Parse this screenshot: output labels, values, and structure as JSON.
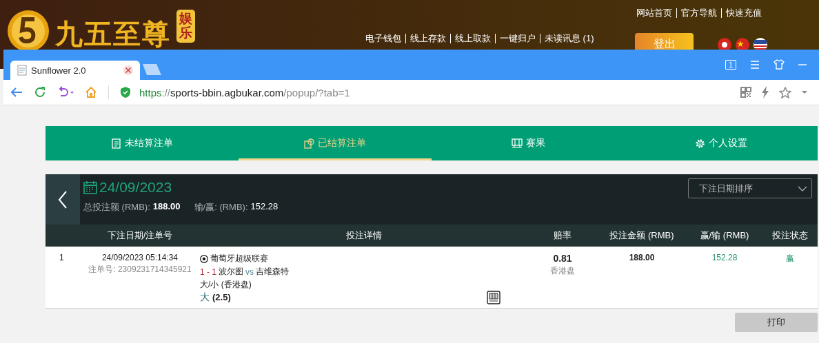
{
  "site": {
    "logo_text": "九五至尊",
    "logo_badge": "娱乐",
    "top_links": [
      "网站首页",
      "官方导航",
      "快速充值"
    ],
    "nav_links": [
      "电子钱包",
      "线上存款",
      "线上取款",
      "一键归户",
      "未读讯息 (1)"
    ],
    "logout": "登出"
  },
  "browser": {
    "tab_title": "Sunflower 2.0",
    "window_count": "1",
    "url_parts": [
      {
        "kind": "scheme",
        "text": "https"
      },
      {
        "kind": "sep",
        "text": "://"
      },
      {
        "kind": "host",
        "text": "sports-bbin.agbukar.com"
      },
      {
        "kind": "path",
        "text": "/popup/?tab=1"
      }
    ]
  },
  "tabs": [
    {
      "label": "未结算注单",
      "selected": false
    },
    {
      "label": "已结算注单",
      "selected": true
    },
    {
      "label": "赛果",
      "selected": false
    },
    {
      "label": "个人设置",
      "selected": false
    }
  ],
  "summary": {
    "date": "24/09/2023",
    "total_label": "总投注额 (RMB):",
    "total_value": "188.00",
    "winloss_label": "输/赢: (RMB):",
    "winloss_value": "152.28",
    "sort": "下注日期排序"
  },
  "table": {
    "columns": [
      "下注日期/注单号",
      "投注详情",
      "赔率",
      "投注金额 (RMB)",
      "赢/输 (RMB)",
      "投注状态"
    ],
    "rows": [
      {
        "index": "1",
        "date": "24/09/2023 05:14:34",
        "ticket": "注单号: 2309231714345921",
        "league": "葡萄牙超级联赛",
        "score": "1 - 1",
        "home": "波尔图",
        "vs": "vs",
        "away": "吉维森特",
        "market": "大/小 (香港盘)",
        "pick": "大",
        "pick_line": "(2.5)",
        "odds": "0.81",
        "odds_type": "香港盘",
        "stake": "188.00",
        "winloss": "152.28",
        "status": "赢"
      }
    ]
  },
  "print": "打印"
}
